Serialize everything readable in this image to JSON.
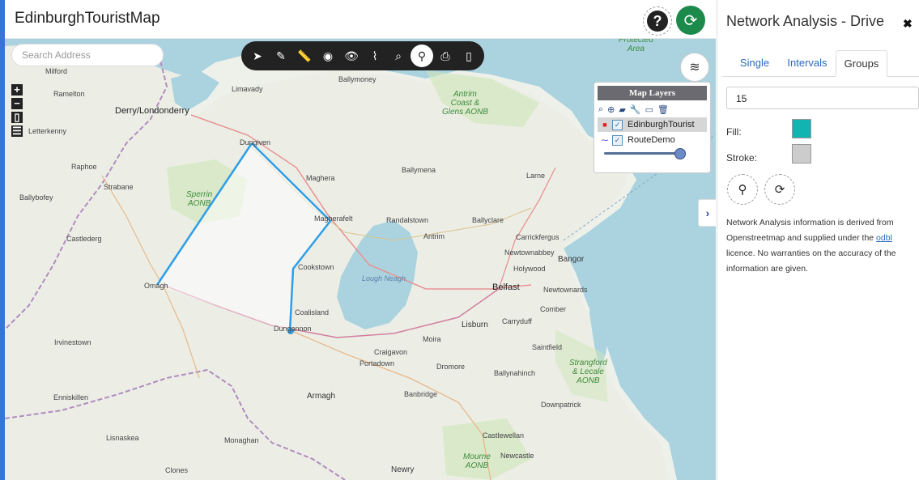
{
  "header": {
    "title": "EdinburghTouristMap"
  },
  "search": {
    "placeholder": "Search Address"
  },
  "toolbar": {
    "tools": [
      "select-arrow-icon",
      "draw-icon",
      "measure-icon",
      "coordinates-icon",
      "visibility-icon",
      "route-icon",
      "search-map-icon",
      "network-analysis-icon",
      "print-icon",
      "bookmark-icon"
    ],
    "active": "network-analysis-icon"
  },
  "map_layers": {
    "title": "Map Layers",
    "layers": [
      {
        "name": "EdinburghTourist",
        "checked": true,
        "selected": true
      },
      {
        "name": "RouteDemo",
        "checked": true,
        "selected": false
      }
    ],
    "opacity": 0.92
  },
  "map": {
    "labels": {
      "milford": "Milford",
      "ramelton": "Ramelton",
      "derry": "Derry/Londonderry",
      "limavady": "Limavady",
      "ballymoney": "Ballymoney",
      "letterkenny": "Letterkenny",
      "antrim_aonb": "Antrim\nCoast &\nGlens AONB",
      "dungiven": "Dungiven",
      "raphoe": "Raphoe",
      "maghera": "Maghera",
      "ballymena": "Ballymena",
      "larne": "Larne",
      "strabane": "Strabane",
      "sperrin": "Sperrin\nAONB",
      "ballybofey": "Ballybofey",
      "magherafelt": "Magherafelt",
      "randalstown": "Randalstown",
      "ballyclare": "Ballyclare",
      "castlederg": "Castlederg",
      "antrim": "Antrim",
      "carrickfergus": "Carrickfergus",
      "newtownabbey": "Newtownabbey",
      "cookstown": "Cookstown",
      "bangor": "Bangor",
      "holywood": "Holywood",
      "omagh": "Omagh",
      "lough_neagh": "Lough Neagh",
      "belfast": "Belfast",
      "newtownards": "Newtownards",
      "coalisland": "Coalisland",
      "comber": "Comber",
      "dungannon": "Dungannon",
      "lisburn": "Lisburn",
      "carryduff": "Carryduff",
      "irvinestown": "Irvinestown",
      "moira": "Moira",
      "saintfield": "Saintfield",
      "craigavon": "Craigavon",
      "portadown": "Portadown",
      "strangford": "Strangford\n& Lecale\nAONB",
      "dromore": "Dromore",
      "ballynahinch": "Ballynahinch",
      "enniskillen": "Enniskillen",
      "armagh": "Armagh",
      "banbridge": "Banbridge",
      "downpatrick": "Downpatrick",
      "lisnaskea": "Lisnaskea",
      "castlewellan": "Castlewellan",
      "monaghan": "Monaghan",
      "mourne": "Mourne\nAONB",
      "newcastle": "Newcastle",
      "clones": "Clones",
      "newry": "Newry",
      "protected": "Protected\nArea"
    }
  },
  "panel": {
    "title": "Network Analysis - Drive",
    "tabs": [
      "Single",
      "Intervals",
      "Groups"
    ],
    "active_tab": "Groups",
    "value": "15",
    "fill_label": "Fill:",
    "fill_color": "#12b3b0",
    "stroke_label": "Stroke:",
    "stroke_color": "#cccccc",
    "info_part1": "Network Analysis information is derived from Openstreetmap and supplied under the ",
    "info_link": "odbl",
    "info_part2": " licence. No warranties on the accuracy of the information are given."
  }
}
